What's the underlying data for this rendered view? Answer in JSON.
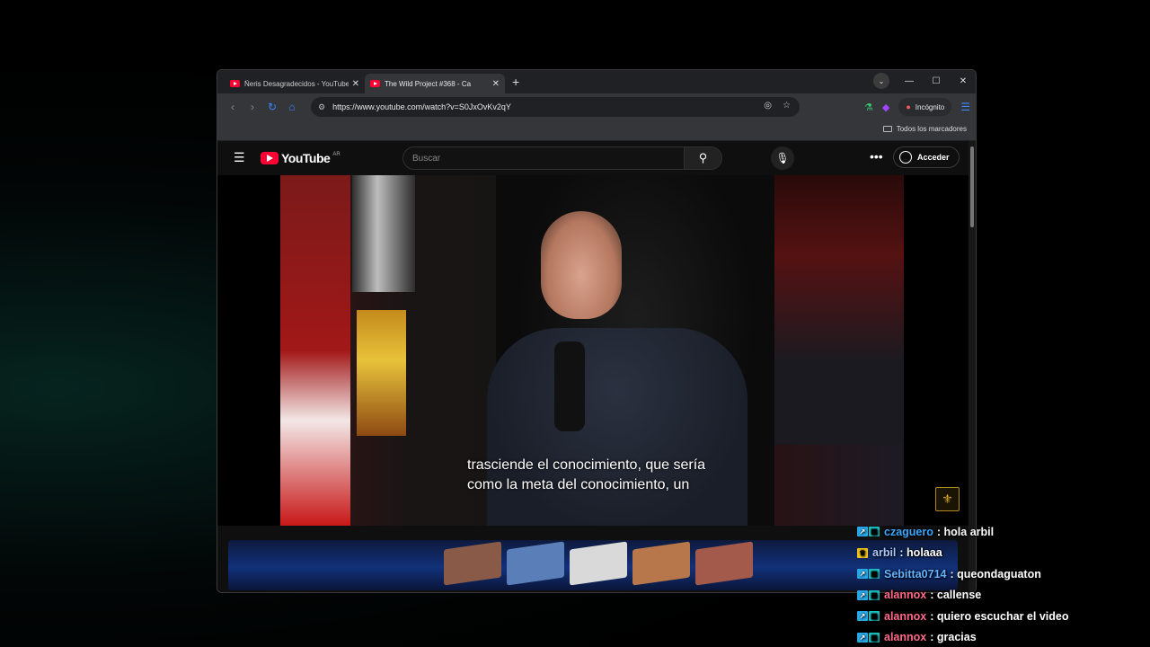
{
  "browser": {
    "tabs": [
      {
        "title": "Ñeris Desagradecidos - YouTube",
        "active": false
      },
      {
        "title": "The Wild Project #368 - Ca",
        "active": true
      }
    ],
    "url": "https://www.youtube.com/watch?v=S0JxOvKv2qY",
    "incognito_label": "Incógnito",
    "bookmarks_all": "Todos los marcadores"
  },
  "youtube": {
    "logo_text": "YouTube",
    "country": "AR",
    "search_placeholder": "Buscar",
    "signin_label": "Acceder",
    "subtitle_line1": "trasciende el conocimiento, que sería",
    "subtitle_line2": "como la meta del conocimiento, un"
  },
  "chat": {
    "messages": [
      {
        "user": "czaguero",
        "color": "#3aa6ff",
        "text": ": hola arbil",
        "badges": [
          "prime",
          "sub"
        ]
      },
      {
        "user": "arbil",
        "color": "#a8c8ff",
        "text": ": holaaa",
        "badges": [
          "crown"
        ]
      },
      {
        "user": "Sebitta0714",
        "color": "#63b3ff",
        "text": ": queondaguaton",
        "badges": [
          "prime",
          "sub"
        ]
      },
      {
        "user": "alannox",
        "color": "#ff6a8a",
        "text": ": callense",
        "badges": [
          "prime",
          "sub"
        ]
      },
      {
        "user": "alannox",
        "color": "#ff6a8a",
        "text": ": quiero escuchar el video",
        "badges": [
          "prime",
          "sub"
        ]
      },
      {
        "user": "alannox",
        "color": "#ff6a8a",
        "text": ": gracias",
        "badges": [
          "prime",
          "sub"
        ]
      }
    ]
  },
  "icons": {
    "back": "arrow-left-icon",
    "forward": "arrow-right-icon",
    "reload": "reload-icon",
    "home": "home-icon",
    "site_info": "tune-icon",
    "eye_off": "eye-off-icon",
    "bookmark": "bookmark-icon",
    "menu": "menu-icon",
    "search": "search-icon",
    "mic": "mic-icon",
    "more": "more-dots-icon"
  }
}
